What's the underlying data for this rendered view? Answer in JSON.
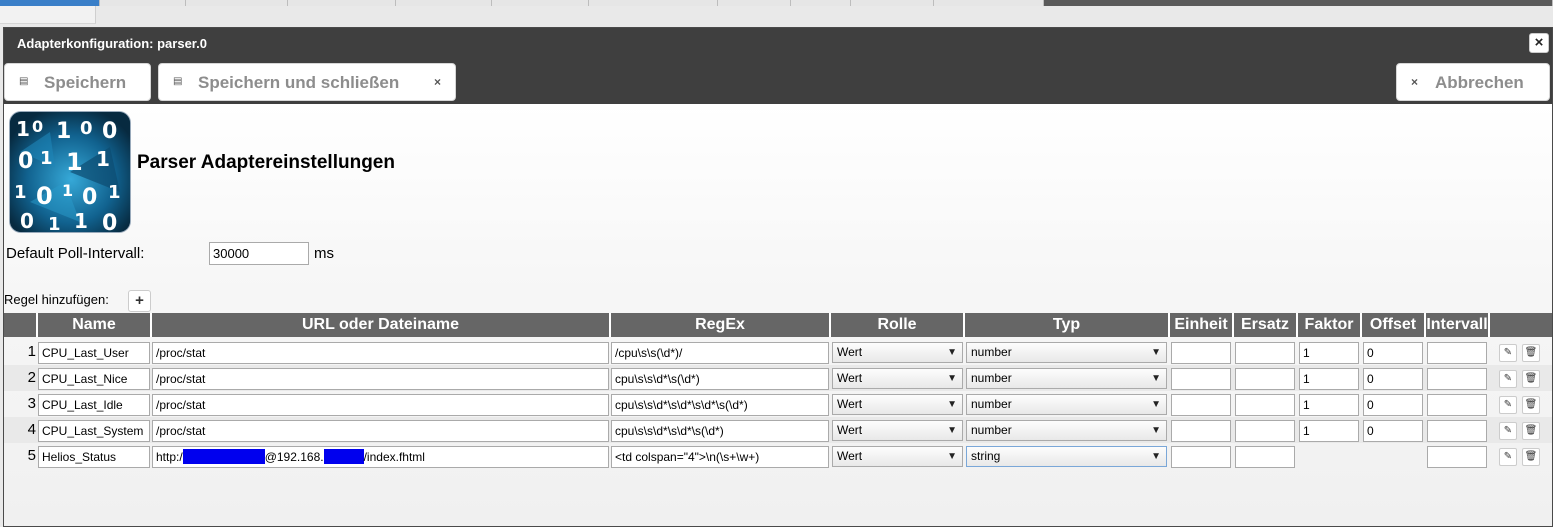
{
  "dialog": {
    "title": "Adapterkonfiguration: parser.0",
    "close_icon": "close-icon"
  },
  "toolbar": {
    "save_label": "Speichern",
    "save_close_label": "Speichern und schließen",
    "cancel_label": "Abbrechen",
    "save_icon": "floppy-disk-icon",
    "cancel_icon": "close-icon"
  },
  "header": {
    "title": "Parser Adaptereinstellungen",
    "logo": "binary-digits-logo"
  },
  "poll": {
    "label": "Default Poll-Intervall:",
    "value": "30000",
    "unit": "ms"
  },
  "add_rule": {
    "label": "Regel hinzufügen:",
    "icon": "plus-icon",
    "symbol": "+"
  },
  "table": {
    "columns": [
      "Name",
      "URL oder Dateiname",
      "RegEx",
      "Rolle",
      "Typ",
      "Einheit",
      "Ersatz",
      "Faktor",
      "Offset",
      "Intervall"
    ],
    "rows": [
      {
        "num": "1",
        "name": "CPU_Last_User",
        "url": "/proc/stat",
        "regex": "/cpu\\s\\s(\\d*)/",
        "role": "Wert",
        "type": "number",
        "unit": "",
        "substitute": "",
        "factor": "1",
        "offset": "0",
        "interval": ""
      },
      {
        "num": "2",
        "name": "CPU_Last_Nice",
        "url": "/proc/stat",
        "regex": "cpu\\s\\s\\d*\\s(\\d*)",
        "role": "Wert",
        "type": "number",
        "unit": "",
        "substitute": "",
        "factor": "1",
        "offset": "0",
        "interval": ""
      },
      {
        "num": "3",
        "name": "CPU_Last_Idle",
        "url": "/proc/stat",
        "regex": "cpu\\s\\s\\d*\\s\\d*\\s\\d*\\s(\\d*)",
        "role": "Wert",
        "type": "number",
        "unit": "",
        "substitute": "",
        "factor": "1",
        "offset": "0",
        "interval": ""
      },
      {
        "num": "4",
        "name": "CPU_Last_System",
        "url": "/proc/stat",
        "regex": "cpu\\s\\s\\d*\\s\\d*\\s(\\d*)",
        "role": "Wert",
        "type": "number",
        "unit": "",
        "substitute": "",
        "factor": "1",
        "offset": "0",
        "interval": ""
      },
      {
        "num": "5",
        "name": "Helios_Status",
        "url_prefix": "http:/",
        "url_middle": "@192.168.",
        "url_suffix": "/index.fhtml",
        "regex": "<td colspan=\"4\">\\n(\\s+\\w+)",
        "role": "Wert",
        "type": "string",
        "unit": "",
        "substitute": "",
        "interval": ""
      }
    ],
    "edit_icon": "pencil-icon",
    "delete_icon": "trash-icon"
  },
  "colors": {
    "titlebar": "#3f3f3f",
    "table_header": "#666666",
    "redaction": "#0000ee",
    "active_tab": "#3a7fc8"
  }
}
